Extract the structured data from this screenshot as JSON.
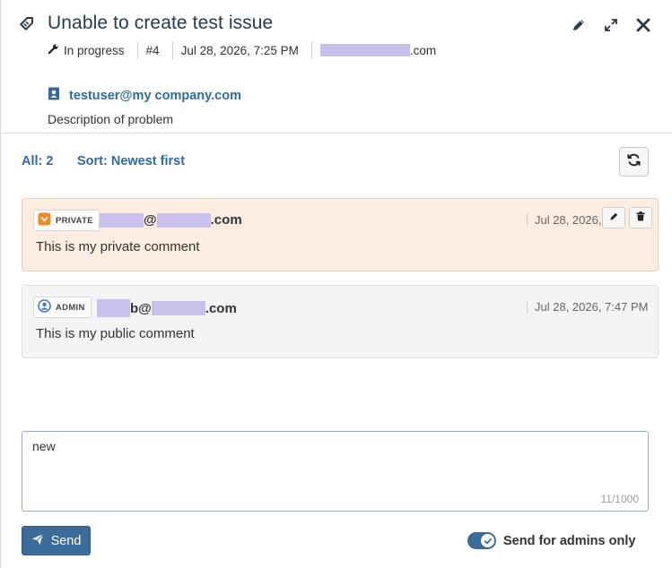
{
  "issue": {
    "title": "Unable to create test issue",
    "status": "In progress",
    "number": "#4",
    "created": "Jul 28, 2026, 7:25 PM",
    "assignee_suffix": ".com",
    "reporter_email": "testuser@my company.com",
    "description": "Description of problem"
  },
  "toolbar": {
    "count_label": "All: 2",
    "sort_label": "Sort: Newest first"
  },
  "comments": [
    {
      "badge": "PRIVATE",
      "author_mid": "@",
      "author_tail": ".com",
      "date": "Jul 28, 2026, 7:47 PM",
      "text": "This is my private comment"
    },
    {
      "badge": "ADMIN",
      "author_mid": "b@",
      "author_tail": ".com",
      "date": "Jul 28, 2026, 7:47 PM",
      "text": "This is my public comment"
    }
  ],
  "composer": {
    "value": "new",
    "char_count": "11/1000",
    "send_label": "Send",
    "toggle_label": "Send for admins only",
    "toggle_on": true
  },
  "icons": {
    "issue": "tag-icon",
    "edit": "pencil-icon",
    "expand": "expand-icon",
    "close": "close-icon",
    "status": "wrench-icon",
    "reporter": "contact-card-icon",
    "refresh": "refresh-icon",
    "private": "shield-icon",
    "admin": "user-circle-icon",
    "delete": "trash-icon",
    "send": "paper-plane-icon",
    "toggle": "check-icon"
  },
  "colors": {
    "accent": "#2f6aa3",
    "button": "#3b6c9a",
    "title": "#243b53",
    "private_bg": "#fdece0",
    "public_bg": "#f3f5f5",
    "private_badge_icon": "#f08a24",
    "admin_badge_icon": "#3a78c9",
    "redaction": "#c9c0ec"
  }
}
